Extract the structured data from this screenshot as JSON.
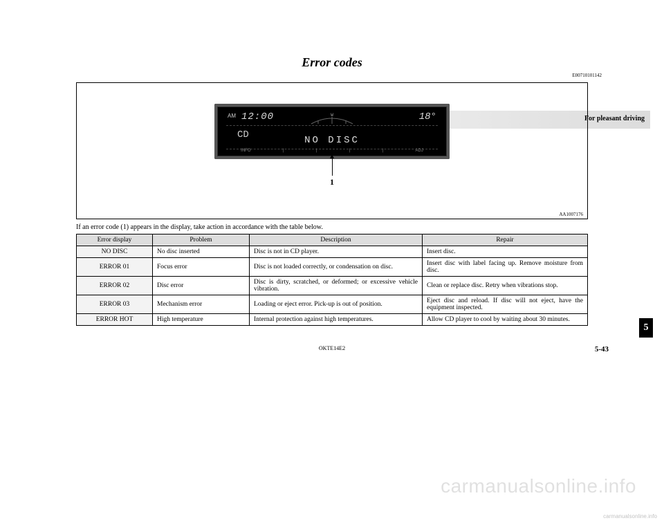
{
  "header": {
    "chapter": "For pleasant driving",
    "title": "Error codes",
    "docCode": "E00710101142"
  },
  "figure": {
    "display": {
      "ampm": "AM",
      "clock": "12:00",
      "temp": "18°",
      "mode": "CD",
      "message": "NO DISC",
      "bottomLabels": {
        "left": "INFO",
        "right": "ADJ"
      }
    },
    "callout": "1",
    "figCode": "AA1007176"
  },
  "intro": "If an error code (1) appears in the display, take action in accordance with the table below.",
  "table": {
    "headers": [
      "Error display",
      "Problem",
      "Description",
      "Repair"
    ],
    "rows": [
      {
        "display": "NO DISC",
        "problem": "No disc inserted",
        "description": "Disc is not in CD player.",
        "repair": "Insert disc."
      },
      {
        "display": "ERROR 01",
        "problem": "Focus error",
        "description": "Disc is not loaded correctly, or condensation on disc.",
        "repair": "Insert disc with label facing up. Remove moisture from disc."
      },
      {
        "display": "ERROR 02",
        "problem": "Disc error",
        "description": "Disc is dirty, scratched, or deformed; or excessive vehicle vibration.",
        "repair": "Clean or replace disc. Retry when vibrations stop."
      },
      {
        "display": "ERROR 03",
        "problem": "Mechanism error",
        "description": "Loading or eject error. Pick-up is out of position.",
        "repair": "Eject disc and reload. If disc will not eject, have the equipment inspected."
      },
      {
        "display": "ERROR HOT",
        "problem": "High temperature",
        "description": "Internal protection against high temperatures.",
        "repair": "Allow CD player to cool by waiting about 30 minutes."
      }
    ]
  },
  "sideTab": "5",
  "footer": {
    "center": "OKTE14E2",
    "right": "5-43"
  },
  "watermark": {
    "large": "carmanualsonline.info",
    "small": "carmanualsonline.info"
  }
}
